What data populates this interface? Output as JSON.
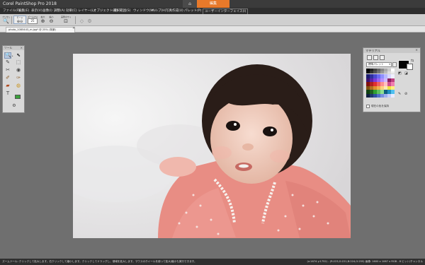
{
  "window": {
    "title": "Corel PaintShop Pro 2018",
    "home_icon": "house-icon",
    "edit_tab": "編集"
  },
  "menu": [
    {
      "label": "ファイル(F)"
    },
    {
      "label": "編集(E)"
    },
    {
      "label": "表示(V)"
    },
    {
      "label": "画像(I)"
    },
    {
      "label": "調整(A)"
    },
    {
      "label": "効果(C)"
    },
    {
      "label": "レイヤー(L)"
    },
    {
      "label": "オブジェクト(O)"
    },
    {
      "label": "選択範囲(S)"
    },
    {
      "label": "ウィンドウ(W)"
    },
    {
      "label": "ヘルプ(H)"
    },
    {
      "label": "写真作成(U)"
    },
    {
      "label": "パレット(P)"
    },
    {
      "label": "ユーザーインターフェイス(I)"
    }
  ],
  "toolbar": {
    "preset_label": "プリセット",
    "mode_label": "モード",
    "zoom_label": "ズーム(%)",
    "zoom_value": "25",
    "zoomin_label": "拡大",
    "zoomout_label": "縮小",
    "actual_label": "実際のサイズ"
  },
  "document": {
    "tab_label": "photo_1085443_m.jpg* @ 25% (背景)",
    "close": "×"
  },
  "tools_palette": {
    "title": "ツール",
    "close": "×"
  },
  "materials_palette": {
    "title": "マテリアル",
    "close": "×",
    "select_value": "標準パレット",
    "checkbox_label": "現在の色を保持",
    "fg_color": "#050505",
    "bg_color": "#ffffff"
  },
  "status": {
    "left": "ズームツール: クリックして拡大します。右クリックして縮小します。クリックしてドラッグし、領域を拡大します。マウスのホイールを使って拡大/縮小も実行できます。",
    "right": "(x:1674 y:1752) - (R:223,G:221,B:224,O:255)  画像: 1600 x 1067 x RGB - 8 ビット/チャンネル"
  }
}
